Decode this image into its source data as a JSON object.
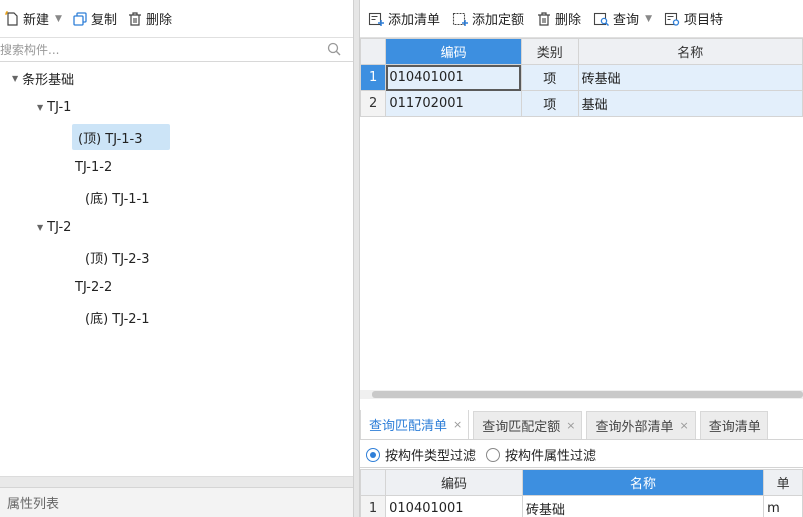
{
  "left_toolbar": {
    "new_label": "新建",
    "copy_label": "复制",
    "delete_label": "删除"
  },
  "search": {
    "placeholder": "搜索构件..."
  },
  "tree": {
    "root": "条形基础",
    "g1": "TJ-1",
    "g1_a": "(顶) TJ-1-3",
    "g1_b": "TJ-1-2",
    "g1_c": "(底) TJ-1-1",
    "g2": "TJ-2",
    "g2_a": "(顶) TJ-2-3",
    "g2_b": "TJ-2-2",
    "g2_c": "(底) TJ-2-1"
  },
  "property_panel": {
    "title": "属性列表"
  },
  "right_toolbar": {
    "add_list": "添加清单",
    "add_quota": "添加定额",
    "delete": "删除",
    "query": "查询",
    "item_feature": "项目特"
  },
  "top_grid": {
    "headers": {
      "code": "编码",
      "category": "类别",
      "name": "名称"
    },
    "rows": [
      {
        "num": "1",
        "code": "010401001",
        "category": "项",
        "name": "砖基础"
      },
      {
        "num": "2",
        "code": "011702001",
        "category": "项",
        "name": "基础"
      }
    ]
  },
  "tabs": [
    {
      "label": "查询匹配清单",
      "close": "×"
    },
    {
      "label": "查询匹配定额",
      "close": "×"
    },
    {
      "label": "查询外部清单",
      "close": "×"
    },
    {
      "label": "查询清单"
    }
  ],
  "filters": {
    "by_type": "按构件类型过滤",
    "by_attr": "按构件属性过滤"
  },
  "bottom_grid": {
    "headers": {
      "code": "编码",
      "name": "名称",
      "unit": "单"
    },
    "rows": [
      {
        "num": "1",
        "code": "010401001",
        "name": "砖基础",
        "unit": "m"
      }
    ]
  },
  "colors": {
    "accent": "#3d8fe0",
    "selected_row": "#e3effb",
    "tree_selected": "#cce4f7"
  }
}
